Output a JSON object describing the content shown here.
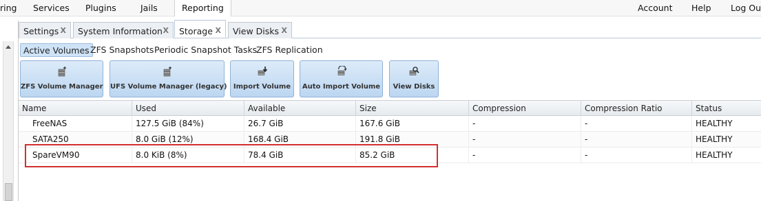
{
  "topnav": {
    "items": [
      {
        "label": "ring"
      },
      {
        "label": "Services"
      },
      {
        "label": "Plugins"
      },
      {
        "label": "Jails"
      },
      {
        "label": "Reporting"
      },
      {
        "label": "Account"
      },
      {
        "label": "Help"
      },
      {
        "label": "Log Out"
      }
    ]
  },
  "tabs": [
    {
      "label": "Settings",
      "close": "X"
    },
    {
      "label": "System Information",
      "close": "X"
    },
    {
      "label": "Storage",
      "close": "X",
      "active": true
    },
    {
      "label": "View Disks",
      "close": "X"
    }
  ],
  "subtabs": [
    {
      "label": "Active Volumes",
      "active": true
    },
    {
      "label": "ZFS Snapshots"
    },
    {
      "label": "Periodic Snapshot Tasks"
    },
    {
      "label": "ZFS Replication"
    }
  ],
  "toolbar": {
    "buttons": [
      {
        "label": "ZFS Volume Manager",
        "icon": "volume-add-icon"
      },
      {
        "label": "UFS Volume Manager (legacy)",
        "icon": "volume-add-icon"
      },
      {
        "label": "Import Volume",
        "icon": "volume-import-icon"
      },
      {
        "label": "Auto Import Volume",
        "icon": "volume-auto-import-icon"
      },
      {
        "label": "View Disks",
        "icon": "volume-search-icon"
      }
    ]
  },
  "table": {
    "columns": [
      "Name",
      "Used",
      "Available",
      "Size",
      "Compression",
      "Compression Ratio",
      "Status"
    ],
    "rows": [
      {
        "name": "FreeNAS",
        "used": "127.5 GiB (84%)",
        "available": "26.7 GiB",
        "size": "167.6 GiB",
        "compression": "-",
        "ratio": "-",
        "status": "HEALTHY"
      },
      {
        "name": "SATA250",
        "used": "8.0 GiB (12%)",
        "available": "168.4 GiB",
        "size": "191.8 GiB",
        "compression": "-",
        "ratio": "-",
        "status": "HEALTHY"
      },
      {
        "name": "SpareVM90",
        "used": "8.0 KiB (8%)",
        "available": "78.4 GiB",
        "size": "85.2 GiB",
        "compression": "-",
        "ratio": "-",
        "status": "HEALTHY"
      }
    ]
  },
  "colors": {
    "accent": "#cfe3f7",
    "button": "#bcd6f1",
    "highlight": "#d42e2e"
  }
}
